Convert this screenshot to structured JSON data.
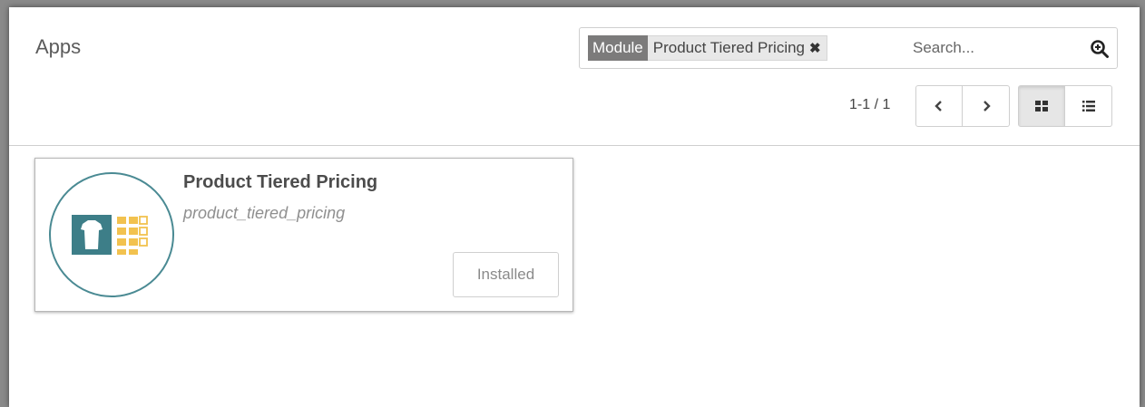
{
  "header": {
    "title": "Apps"
  },
  "search": {
    "facet_label": "Module",
    "facet_value": "Product Tiered Pricing",
    "facet_remove_glyph": "✖",
    "placeholder": "Search..."
  },
  "pager": {
    "value": "1-1 / 1",
    "prev_glyph": "‹",
    "next_glyph": "›"
  },
  "view_switcher": {
    "active": "kanban"
  },
  "modules": [
    {
      "name": "Product Tiered Pricing",
      "technical_name": "product_tiered_pricing",
      "status": "Installed",
      "icon": "tshirt-pricing-icon"
    }
  ],
  "colors": {
    "icon_teal": "#3d7e88",
    "icon_yellow": "#f2c24f",
    "facet_dark": "#7c7b7b"
  }
}
